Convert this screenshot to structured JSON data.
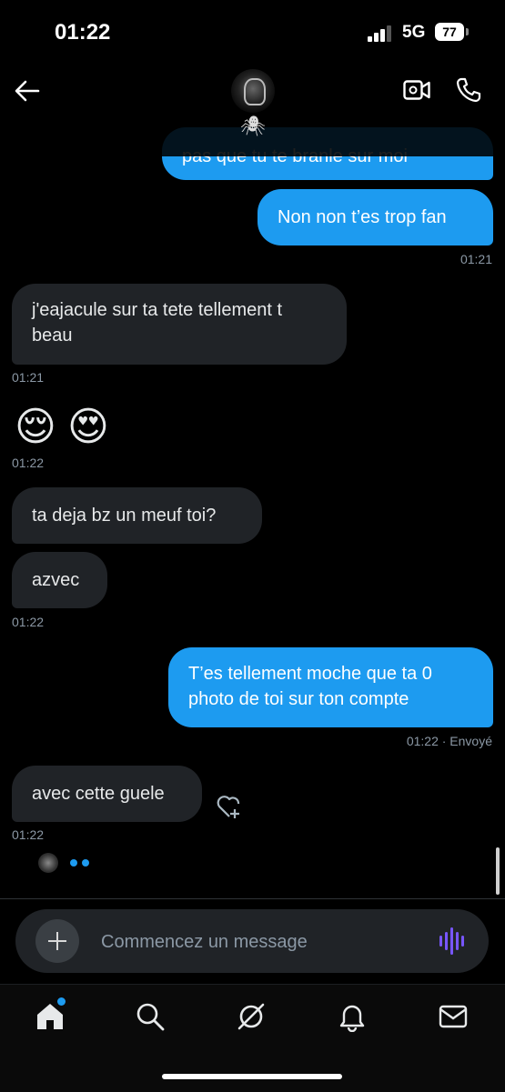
{
  "status_bar": {
    "time": "01:22",
    "network": "5G",
    "battery": "77",
    "battery_level": 0.77
  },
  "header": {
    "avatar_icon": "spider-avatar",
    "sub_icon": "🕷",
    "back_icon": "arrow-left-icon",
    "video_icon": "video-call-icon",
    "phone_icon": "phone-icon"
  },
  "messages": {
    "m0": "pas que tu te branle sur moi",
    "m1": "Non non t’es trop fan",
    "t1": "01:21",
    "m2": "j'eajacule sur ta tete tellement t beau",
    "t2": "01:21",
    "m3_a": "😌",
    "m3_b": "😍",
    "t3": "01:22",
    "m4": "ta deja bz un meuf toi?",
    "m5": "azvec",
    "t5": "01:22",
    "m6": "T’es tellement moche que ta 0 photo de toi sur ton compte",
    "t6": "01:22 · Envoyé",
    "m7": "avec cette guele",
    "t7": "01:22"
  },
  "composer": {
    "placeholder": "Commencez un message"
  },
  "nav": {
    "items": [
      "home",
      "search",
      "grok",
      "notifications",
      "messages"
    ]
  },
  "colors": {
    "accent": "#1d9bf0",
    "incoming_bubble": "#202327",
    "voice": "#7856ff",
    "background": "#000000"
  }
}
